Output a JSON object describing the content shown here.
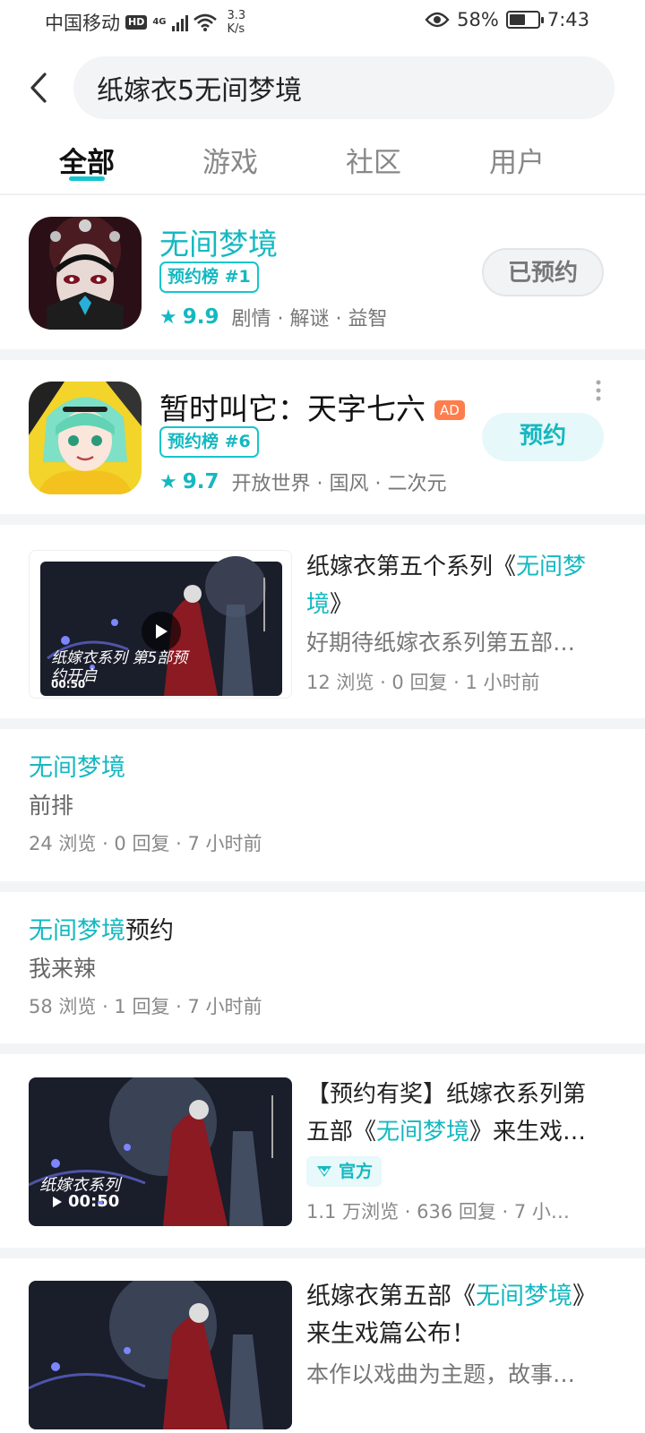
{
  "status_bar": {
    "carrier": "中国移动",
    "hd": "HD",
    "network": "4G",
    "speed_value": "3.3",
    "speed_unit": "K/s",
    "battery": "58%",
    "battery_level": 0.58,
    "time": "7:43"
  },
  "search": {
    "query": "纸嫁衣5无间梦境"
  },
  "tabs": [
    {
      "label": "全部",
      "active": true
    },
    {
      "label": "游戏",
      "active": false
    },
    {
      "label": "社区",
      "active": false
    },
    {
      "label": "用户",
      "active": false
    }
  ],
  "games": [
    {
      "title": "无间梦境",
      "rank": "预约榜 #1",
      "score": "9.9",
      "tags": "剧情 · 解谜 · 益智",
      "action": "已预约"
    },
    {
      "title": "暂时叫它：天字七六",
      "ad": "AD",
      "rank": "预约榜 #6",
      "score": "9.7",
      "tags": "开放世界 · 国风 · 二次元",
      "action": "预约"
    }
  ],
  "posts": {
    "p1": {
      "title_prefix": "纸嫁衣第五个系列《",
      "title_hl": "无间梦境",
      "title_suffix": "》",
      "desc": "好期待纸嫁衣系列第五部…",
      "meta": "12 浏览 · 0 回复 · 1 小时前",
      "thumb_text": "纸嫁衣系列 第5部预约开启",
      "duration": "00:50"
    },
    "p2": {
      "title_hl": "无间梦境",
      "body": "前排",
      "meta": "24 浏览 · 0 回复 · 7 小时前"
    },
    "p3": {
      "title_hl": "无间梦境",
      "title_suffix": "预约",
      "body": "我来辣",
      "meta": "58 浏览 · 1 回复 · 7 小时前"
    },
    "p4": {
      "title_line1": "【预约有奖】纸嫁衣系列第",
      "title_prefix": "五部《",
      "title_hl": "无间梦境",
      "title_suffix": "》来生戏…",
      "official": "官方",
      "meta": "1.1 万浏览 · 636 回复 · 7 小…",
      "thumb_text": "纸嫁衣系列",
      "duration": "00:50"
    },
    "p5": {
      "title_prefix": "纸嫁衣第五部《",
      "title_hl": "无间梦境",
      "title_suffix": "》",
      "title_line2": "来生戏篇公布！",
      "desc": "本作以戏曲为主题，故事…"
    }
  },
  "colors": {
    "accent": "#15c5ce",
    "accent_text": "#15b8c1",
    "ad": "#ff7d4c",
    "separator": "#f3f4f6"
  },
  "icons": [
    "back-arrow-icon",
    "eye-icon",
    "wifi-icon",
    "battery-icon",
    "star-icon",
    "more-dots-icon",
    "play-icon",
    "official-badge-icon"
  ]
}
